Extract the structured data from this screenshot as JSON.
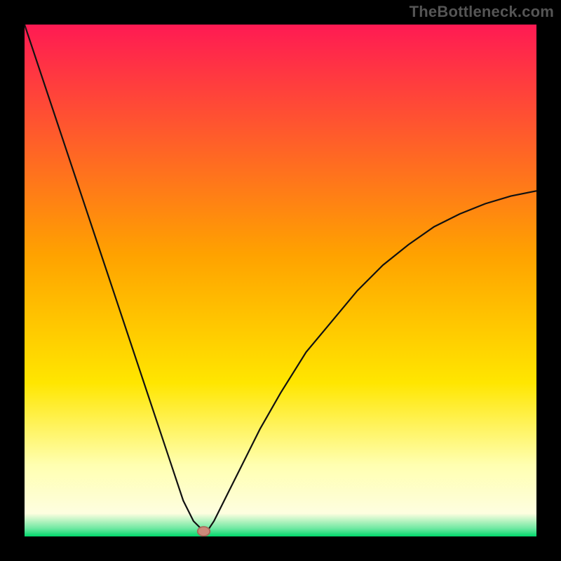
{
  "watermark": "TheBottleneck.com",
  "chart_data": {
    "type": "line",
    "title": "",
    "xlabel": "",
    "ylabel": "",
    "xlim": [
      0,
      100
    ],
    "ylim": [
      0,
      100
    ],
    "grid": false,
    "legend": false,
    "x": [
      0,
      2,
      4,
      6,
      8,
      10,
      12,
      14,
      16,
      18,
      20,
      22,
      24,
      26,
      28,
      30,
      31,
      32,
      33,
      34,
      35,
      36,
      37,
      38,
      40,
      42,
      46,
      50,
      55,
      60,
      65,
      70,
      75,
      80,
      85,
      90,
      95,
      100
    ],
    "values": [
      100,
      94,
      88,
      82,
      76,
      70,
      64,
      58,
      52,
      46,
      40,
      34,
      28,
      22,
      16,
      10,
      7,
      5,
      3,
      2,
      1,
      1.5,
      3,
      5,
      9,
      13,
      21,
      28,
      36,
      42,
      48,
      53,
      57,
      60.5,
      63,
      65,
      66.5,
      67.5
    ],
    "dip_marker": {
      "x": 35,
      "y": 1
    },
    "gradient_stops": [
      {
        "offset": 0.0,
        "color": "#ff1a53"
      },
      {
        "offset": 0.45,
        "color": "#ffa200"
      },
      {
        "offset": 0.7,
        "color": "#ffe600"
      },
      {
        "offset": 0.86,
        "color": "#ffffb0"
      },
      {
        "offset": 0.955,
        "color": "#fefee0"
      },
      {
        "offset": 0.985,
        "color": "#6be8a0"
      },
      {
        "offset": 1.0,
        "color": "#00d86b"
      }
    ],
    "background": "#000000",
    "frame_color": "#000000",
    "curve_color": "#111111",
    "marker_fill": "#cc8a7a",
    "marker_stroke": "#a86a5a"
  }
}
